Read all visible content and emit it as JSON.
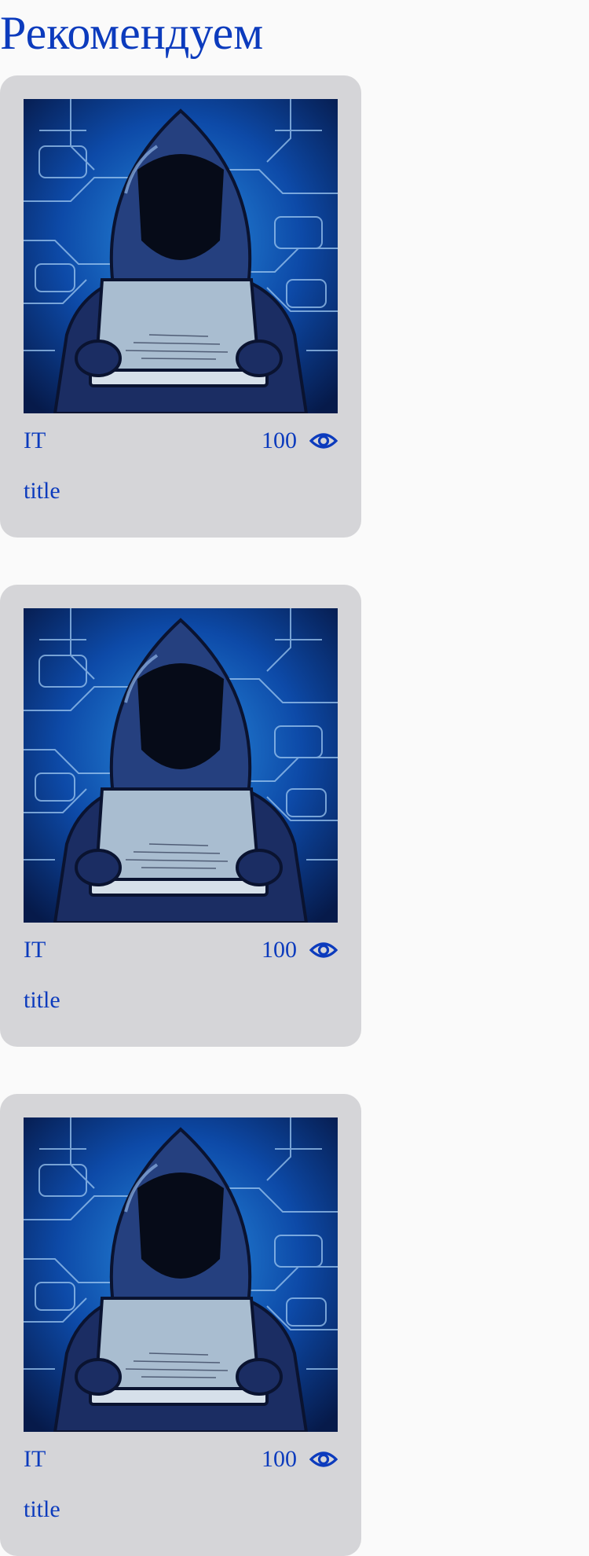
{
  "page": {
    "title": "Рекомендуем"
  },
  "cards": [
    {
      "category": "IT",
      "views": "100",
      "title": "title",
      "image_icon": "hooded-hacker-laptop",
      "view_icon": "eye-icon"
    },
    {
      "category": "IT",
      "views": "100",
      "title": "title",
      "image_icon": "hooded-hacker-laptop",
      "view_icon": "eye-icon"
    },
    {
      "category": "IT",
      "views": "100",
      "title": "title",
      "image_icon": "hooded-hacker-laptop",
      "view_icon": "eye-icon"
    }
  ],
  "colors": {
    "accent": "#0c3bbd",
    "card_background": "#d5d5d8",
    "page_background": "#fafafa"
  }
}
